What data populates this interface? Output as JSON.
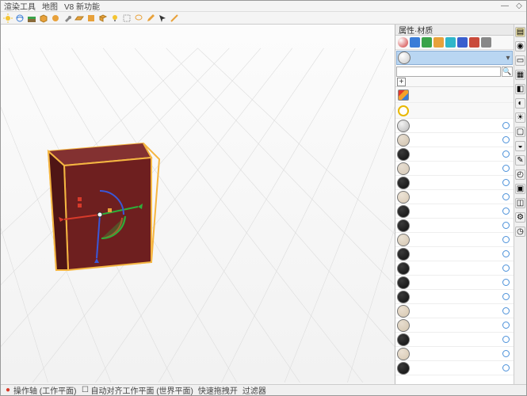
{
  "menu": {
    "items": [
      "渲染工具",
      "地图",
      "V8 新功能"
    ]
  },
  "panel": {
    "title": "属性·材质",
    "search_placeholder": "",
    "add_label": "+",
    "icon_colors": [
      "#d03838",
      "#3a7dd8",
      "#3aa34a",
      "#e8a13a",
      "#2fb6c9",
      "#3a5fce",
      "#c94a3a",
      "#888888"
    ],
    "palette_rows": [
      {
        "kind": "stack",
        "colors": [
          "#e6392e",
          "#f4a12a",
          "#3a7dd8"
        ]
      },
      {
        "kind": "ring",
        "color": "#e8b800"
      }
    ],
    "current_material": {
      "swatch_colors": [
        "#efefef",
        "#c9c9c9"
      ]
    },
    "materials": [
      {
        "thumb": [
          "#f2f2f2",
          "#b8b8b8"
        ],
        "flag": true
      },
      {
        "thumb": [
          "#e7ddd0",
          "#cfc2ad"
        ],
        "flag": true
      },
      {
        "thumb": [
          "#3a3a3a",
          "#0e0e0e"
        ],
        "flag": true
      },
      {
        "thumb": [
          "#e6ddd1",
          "#d4c7b4"
        ],
        "flag": true
      },
      {
        "thumb": [
          "#3a3a3a",
          "#0f0f0f"
        ],
        "flag": true
      },
      {
        "thumb": [
          "#ece3d6",
          "#d8c9b4"
        ],
        "flag": true
      },
      {
        "thumb": [
          "#3a3a3a",
          "#121212"
        ],
        "flag": true
      },
      {
        "thumb": [
          "#3b3b3b",
          "#111111"
        ],
        "flag": true
      },
      {
        "thumb": [
          "#e9e0d2",
          "#d4c6b1"
        ],
        "flag": true
      },
      {
        "thumb": [
          "#3a3a3a",
          "#101010"
        ],
        "flag": true
      },
      {
        "thumb": [
          "#3b3b3b",
          "#111111"
        ],
        "flag": true
      },
      {
        "thumb": [
          "#3a3a3a",
          "#0f0f0f"
        ],
        "flag": true
      },
      {
        "thumb": [
          "#3a3a3a",
          "#111111"
        ],
        "flag": true
      },
      {
        "thumb": [
          "#eadfd0",
          "#d6c7b0"
        ],
        "flag": true
      },
      {
        "thumb": [
          "#e7ddcf",
          "#d3c5ae"
        ],
        "flag": true
      },
      {
        "thumb": [
          "#3a3a3a",
          "#101010"
        ],
        "flag": true
      },
      {
        "thumb": [
          "#ebe1d3",
          "#d7c8b2"
        ],
        "flag": true
      },
      {
        "thumb": [
          "#3a3a3a",
          "#0f0f0f"
        ],
        "flag": true
      }
    ]
  },
  "status": {
    "items": [
      "操作轴 (工作平面)",
      "自动对齐工作平面 (世界平面)",
      "快速拖拽开",
      "过滤器"
    ]
  },
  "toolbar_icons": [
    "sun",
    "cloud",
    "tree",
    "box",
    "sphere",
    "cone",
    "torus",
    "wrench",
    "plane",
    "wrench2",
    "clip",
    "lasso",
    "pencil",
    "paint",
    "arrow"
  ],
  "side_tabs": [
    "layers",
    "globe",
    "folder",
    "db",
    "wrench",
    "gear",
    "doc",
    "image",
    "camera",
    "light",
    "fx",
    "diag",
    "clock"
  ],
  "colors": {
    "selection_outline": "#f5b642",
    "cube_face": "#6e1f1f",
    "cube_face_dark": "#4f1515",
    "cube_top": "#833131",
    "axis_red": "#d83a2a",
    "axis_green": "#2fae3a",
    "axis_blue": "#3a58d8"
  }
}
